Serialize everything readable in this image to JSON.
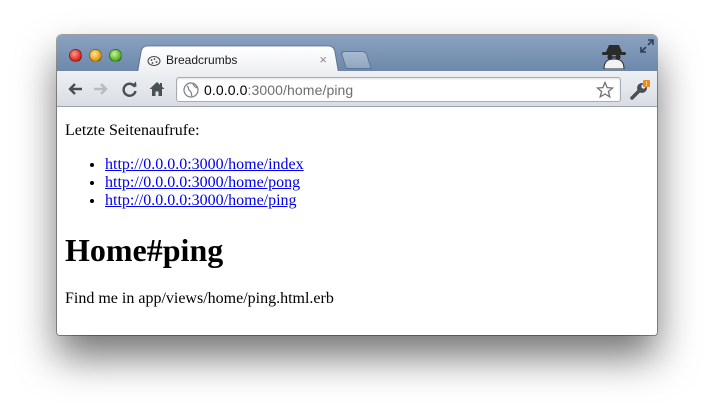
{
  "browser": {
    "tab": {
      "title": "Breadcrumbs",
      "close": "×",
      "favicon": "breadcrumbs-favicon-icon"
    },
    "url": {
      "host": "0.0.0.0",
      "rest": ":3000/home/ping"
    },
    "colors": {
      "titlebar": "#7590b2",
      "link": "#0000ee"
    }
  },
  "page": {
    "intro": "Letzte Seitenaufrufe:",
    "links": [
      "http://0.0.0.0:3000/home/index",
      "http://0.0.0.0:3000/home/pong",
      "http://0.0.0.0:3000/home/ping"
    ],
    "heading": "Home#ping",
    "footer": "Find me in app/views/home/ping.html.erb"
  }
}
